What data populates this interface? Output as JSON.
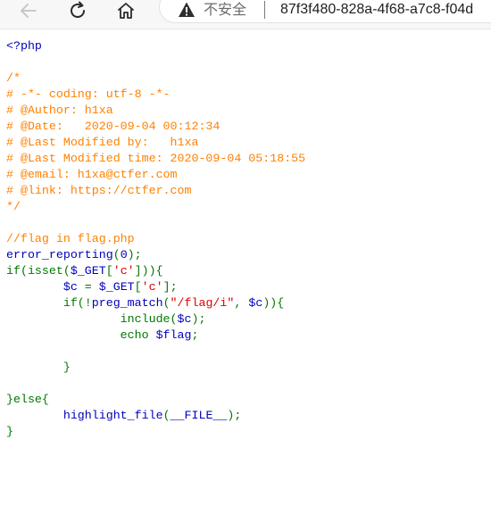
{
  "browser": {
    "security_label": "不安全",
    "url": "87f3f480-828a-4f68-a7c8-f04d",
    "icons": {
      "back": "back-arrow-icon",
      "reload": "reload-icon",
      "home": "home-icon",
      "warning": "warning-icon"
    }
  },
  "colors": {
    "default": "#0000BB",
    "comment": "#FF8000",
    "keyword": "#007700",
    "string": "#DD0000"
  },
  "source_lines": [
    [
      {
        "t": "<?php",
        "c": "default"
      }
    ],
    [],
    [
      {
        "t": "/*",
        "c": "comment"
      }
    ],
    [
      {
        "t": "# -*- coding: utf-8 -*-",
        "c": "comment"
      }
    ],
    [
      {
        "t": "# @Author: h1xa",
        "c": "comment"
      }
    ],
    [
      {
        "t": "# @Date:   2020-09-04 00:12:34",
        "c": "comment"
      }
    ],
    [
      {
        "t": "# @Last Modified by:   h1xa",
        "c": "comment"
      }
    ],
    [
      {
        "t": "# @Last Modified time: 2020-09-04 05:18:55",
        "c": "comment"
      }
    ],
    [
      {
        "t": "# @email: h1xa@ctfer.com",
        "c": "comment"
      }
    ],
    [
      {
        "t": "# @link: https://ctfer.com",
        "c": "comment"
      }
    ],
    [
      {
        "t": "*/",
        "c": "comment"
      }
    ],
    [],
    [
      {
        "t": "//flag in flag.php",
        "c": "comment"
      }
    ],
    [
      {
        "t": "error_reporting",
        "c": "default"
      },
      {
        "t": "(",
        "c": "keyword"
      },
      {
        "t": "0",
        "c": "default"
      },
      {
        "t": ");",
        "c": "keyword"
      }
    ],
    [
      {
        "t": "if(isset(",
        "c": "keyword"
      },
      {
        "t": "$_GET",
        "c": "default"
      },
      {
        "t": "[",
        "c": "keyword"
      },
      {
        "t": "'c'",
        "c": "string"
      },
      {
        "t": "])){",
        "c": "keyword"
      }
    ],
    [
      {
        "t": "        ",
        "c": "keyword"
      },
      {
        "t": "$c ",
        "c": "default"
      },
      {
        "t": "= ",
        "c": "keyword"
      },
      {
        "t": "$_GET",
        "c": "default"
      },
      {
        "t": "[",
        "c": "keyword"
      },
      {
        "t": "'c'",
        "c": "string"
      },
      {
        "t": "];",
        "c": "keyword"
      }
    ],
    [
      {
        "t": "        if(!",
        "c": "keyword"
      },
      {
        "t": "preg_match",
        "c": "default"
      },
      {
        "t": "(",
        "c": "keyword"
      },
      {
        "t": "\"/flag/i\"",
        "c": "string"
      },
      {
        "t": ", ",
        "c": "keyword"
      },
      {
        "t": "$c",
        "c": "default"
      },
      {
        "t": ")){",
        "c": "keyword"
      }
    ],
    [
      {
        "t": "                include(",
        "c": "keyword"
      },
      {
        "t": "$c",
        "c": "default"
      },
      {
        "t": ");",
        "c": "keyword"
      }
    ],
    [
      {
        "t": "                echo ",
        "c": "keyword"
      },
      {
        "t": "$flag",
        "c": "default"
      },
      {
        "t": ";",
        "c": "keyword"
      }
    ],
    [],
    [
      {
        "t": "        }",
        "c": "keyword"
      }
    ],
    [],
    [
      {
        "t": "}else{",
        "c": "keyword"
      }
    ],
    [
      {
        "t": "        ",
        "c": "keyword"
      },
      {
        "t": "highlight_file",
        "c": "default"
      },
      {
        "t": "(",
        "c": "keyword"
      },
      {
        "t": "__FILE__",
        "c": "default"
      },
      {
        "t": ");",
        "c": "keyword"
      }
    ],
    [
      {
        "t": "}",
        "c": "keyword"
      }
    ]
  ]
}
